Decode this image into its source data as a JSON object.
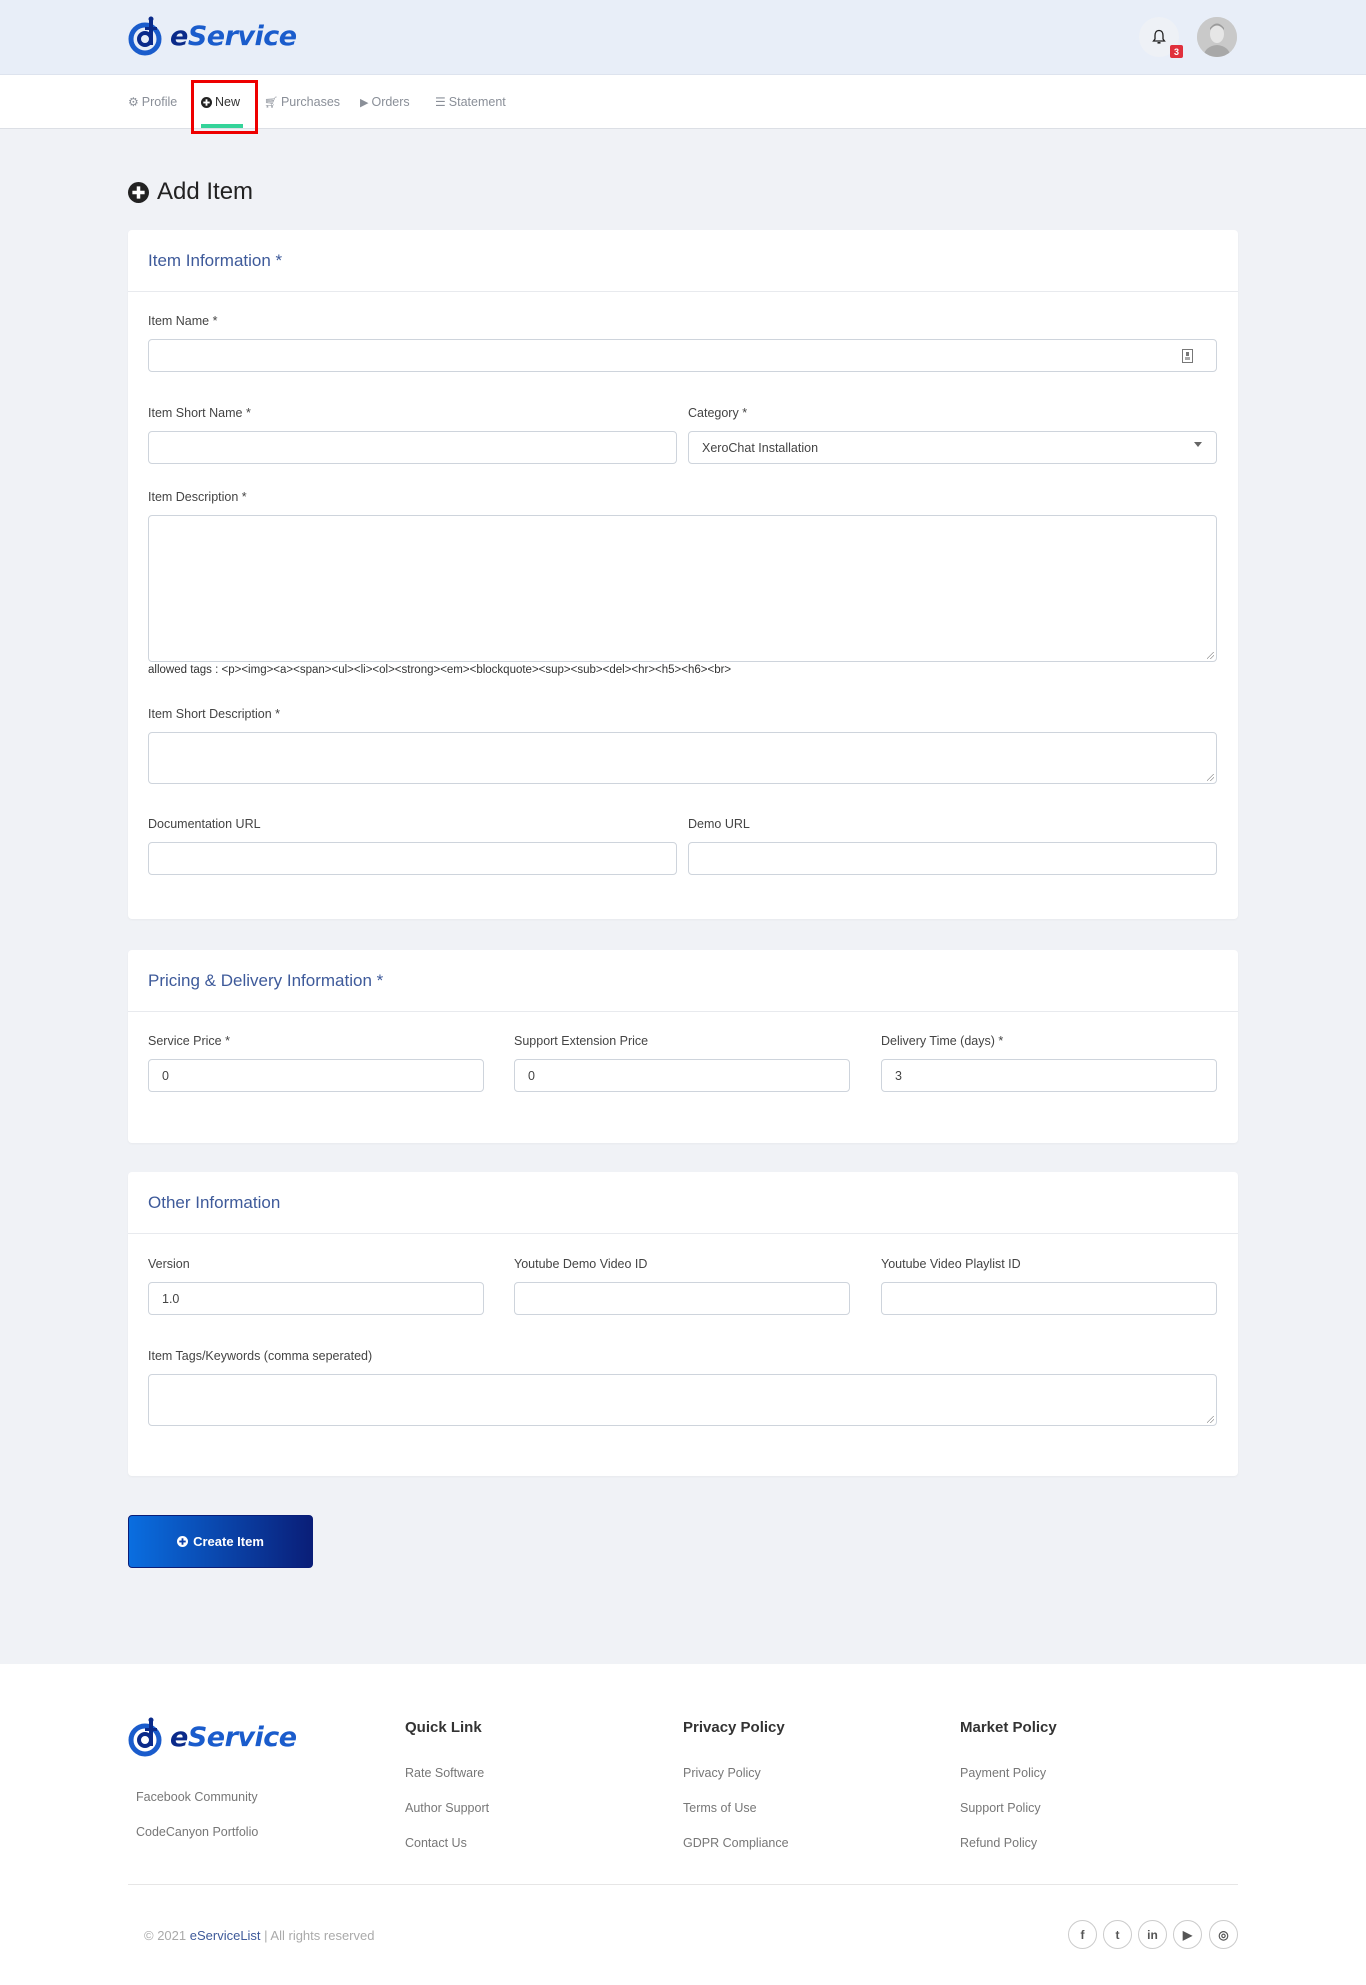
{
  "brand": {
    "name_e": "e",
    "name_rest": "Service"
  },
  "header": {
    "notification_count": "3"
  },
  "nav": {
    "items": [
      {
        "label": "Profile",
        "icon": "gear-icon"
      },
      {
        "label": "New",
        "icon": "plus-circle-icon",
        "active": true
      },
      {
        "label": "Purchases",
        "icon": "cart-icon"
      },
      {
        "label": "Orders",
        "icon": "play-icon"
      },
      {
        "label": "Statement",
        "icon": "list-icon"
      }
    ]
  },
  "page": {
    "title": "Add Item"
  },
  "item_info": {
    "title": "Item Information *",
    "item_name_label": "Item Name *",
    "item_name_value": "",
    "short_name_label": "Item Short Name *",
    "short_name_value": "",
    "category_label": "Category *",
    "category_value": "XeroChat Installation",
    "description_label": "Item Description *",
    "allowed_tags": "allowed tags : <p><img><a><span><ul><li><ol><strong><em><blockquote><sup><sub><del><hr><h5><h6><br>",
    "short_description_label": "Item Short Description *",
    "documentation_url_label": "Documentation URL",
    "demo_url_label": "Demo URL"
  },
  "pricing": {
    "title": "Pricing & Delivery Information *",
    "service_price_label": "Service Price *",
    "service_price_value": "0",
    "support_ext_label": "Support Extension Price",
    "support_ext_value": "0",
    "delivery_label": "Delivery Time (days) *",
    "delivery_value": "3"
  },
  "other": {
    "title": "Other Information",
    "version_label": "Version",
    "version_value": "1.0",
    "yt_demo_label": "Youtube Demo Video ID",
    "yt_playlist_label": "Youtube Video Playlist ID",
    "tags_label": "Item Tags/Keywords (comma seperated)"
  },
  "actions": {
    "create_label": "Create Item"
  },
  "footer": {
    "left_links": [
      "Facebook Community",
      "CodeCanyon Portfolio"
    ],
    "columns": [
      {
        "heading": "Quick Link",
        "links": [
          "Rate Software",
          "Author Support",
          "Contact Us"
        ]
      },
      {
        "heading": "Privacy Policy",
        "links": [
          "Privacy Policy",
          "Terms of Use",
          "GDPR Compliance"
        ]
      },
      {
        "heading": "Market Policy",
        "links": [
          "Payment Policy",
          "Support Policy",
          "Refund Policy"
        ]
      }
    ],
    "copyright_prefix": "© 2021 ",
    "copyright_brand": "eServiceList",
    "copyright_suffix": " | All rights reserved",
    "social": [
      {
        "name": "facebook",
        "glyph": "f"
      },
      {
        "name": "twitter",
        "glyph": "t"
      },
      {
        "name": "linkedin",
        "glyph": "in"
      },
      {
        "name": "youtube",
        "glyph": "▶"
      },
      {
        "name": "instagram",
        "glyph": "◎"
      }
    ]
  }
}
